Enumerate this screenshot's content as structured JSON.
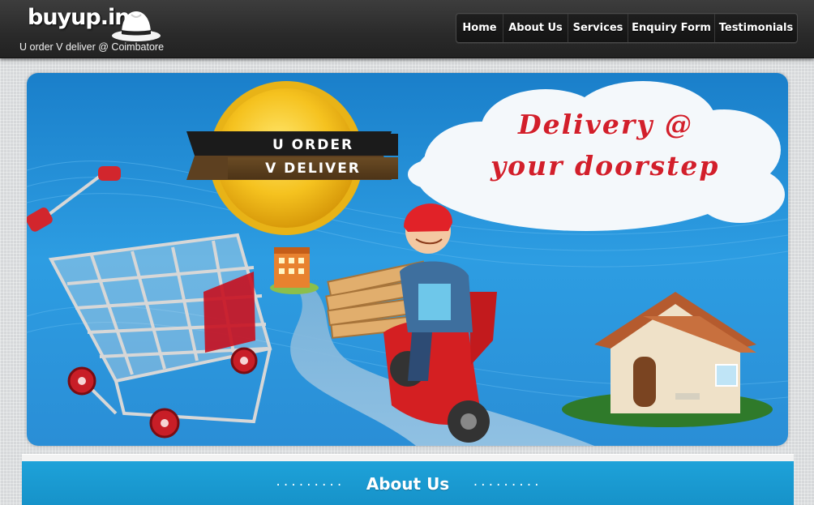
{
  "header": {
    "logo_text": "buyup.in",
    "tagline": "U order V deliver @ Coimbatore",
    "logo_icon": "fedora-hat-icon"
  },
  "nav": {
    "items": [
      {
        "label": "Home"
      },
      {
        "label": "About Us"
      },
      {
        "label": "Services"
      },
      {
        "label": "Enquiry Form"
      },
      {
        "label": "Testimonials"
      }
    ]
  },
  "banner": {
    "badge_line1": "U ORDER",
    "badge_line2": "V DELIVER",
    "headline_line1": "Delivery @",
    "headline_line2": "your doorstep"
  },
  "section": {
    "title": "About Us",
    "dots_left": ".........",
    "dots_right": "........."
  },
  "colors": {
    "header_bg": "#2d2d2d",
    "sky_blue": "#2c9be0",
    "section_blue": "#1a9ad2",
    "headline_red": "#d21f2b"
  }
}
